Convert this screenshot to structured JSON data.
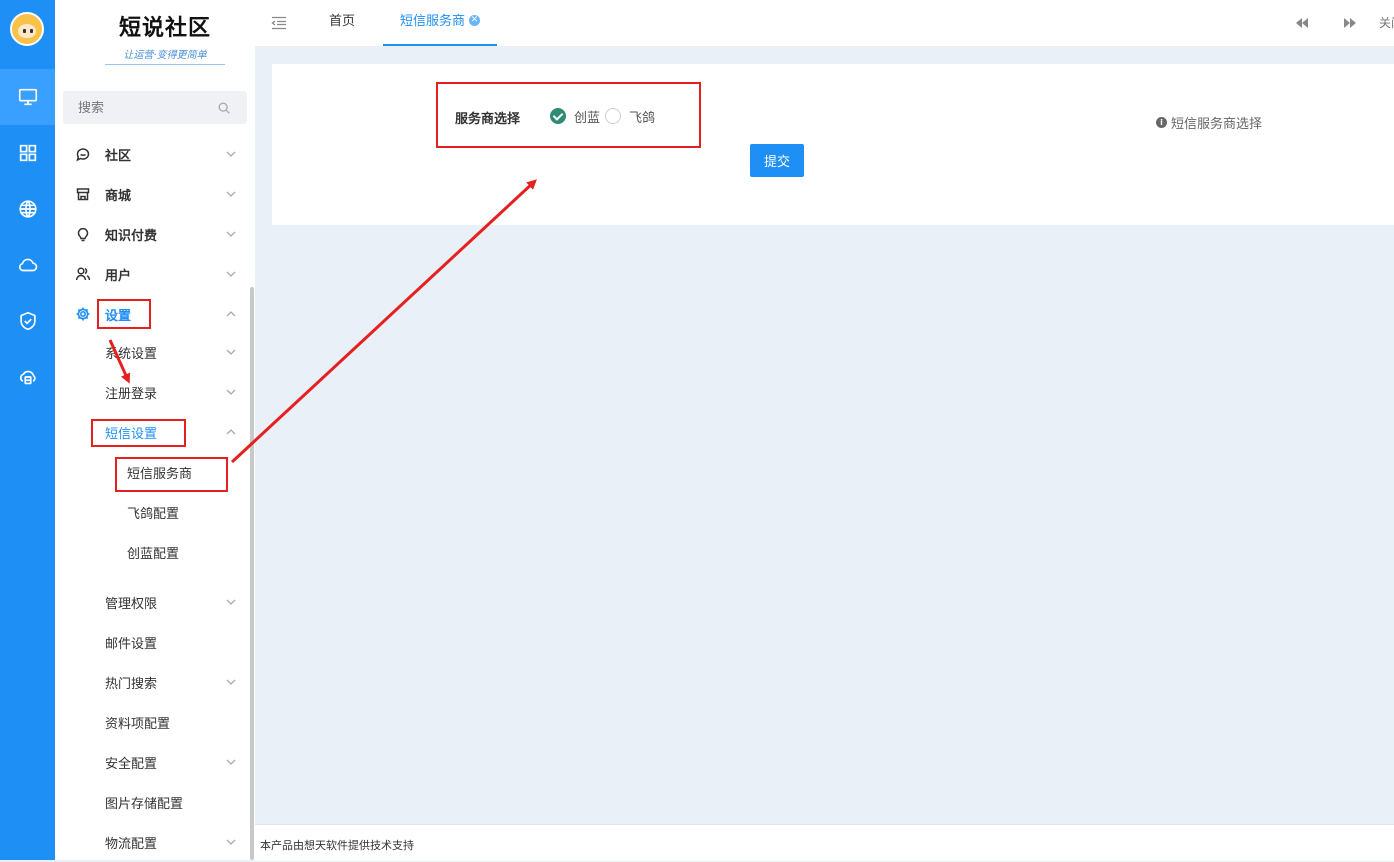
{
  "brand": {
    "name": "短说社区",
    "slogan": "让运营·变得更简单"
  },
  "search": {
    "placeholder": "搜索"
  },
  "sidebar": {
    "items": [
      {
        "label": "社区",
        "icon": "chat-icon"
      },
      {
        "label": "商城",
        "icon": "store-icon"
      },
      {
        "label": "知识付费",
        "icon": "bulb-icon"
      },
      {
        "label": "用户",
        "icon": "users-icon"
      },
      {
        "label": "设置",
        "icon": "gear-icon"
      }
    ],
    "settings_children": [
      {
        "label": "系统设置"
      },
      {
        "label": "注册登录"
      },
      {
        "label": "短信设置"
      }
    ],
    "sms_children": [
      {
        "label": "短信服务商"
      },
      {
        "label": "飞鸽配置"
      },
      {
        "label": "创蓝配置"
      }
    ],
    "more": [
      {
        "label": "管理权限"
      },
      {
        "label": "邮件设置"
      },
      {
        "label": "热门搜索"
      },
      {
        "label": "资料项配置"
      },
      {
        "label": "安全配置"
      },
      {
        "label": "图片存储配置"
      },
      {
        "label": "物流配置"
      }
    ]
  },
  "tabs": {
    "home": "首页",
    "current": "短信服务商",
    "close_text": "关闭"
  },
  "form": {
    "label": "服务商选择",
    "options": [
      {
        "label": "创蓝",
        "checked": true
      },
      {
        "label": "飞鸽",
        "checked": false
      }
    ],
    "hint": "短信服务商选择",
    "submit": "提交"
  },
  "footer": {
    "text": "本产品由想天软件提供技术支持"
  },
  "colors": {
    "primary": "#1e90f5",
    "rail": "#1e90f5",
    "checked": "#2e8b75",
    "annotation": "#e62020"
  }
}
